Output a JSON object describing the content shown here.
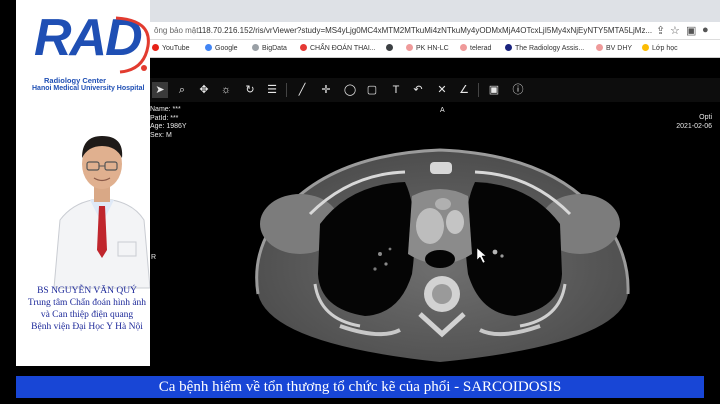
{
  "logo": {
    "letters": "RAD",
    "center_name": "Radiology Center",
    "hospital_name": "Hanoi Medical University Hospital"
  },
  "presenter": {
    "name": "BS NGUYỄN VĂN QUÝ",
    "line2": "Trung tâm Chẩn đoán hình ảnh",
    "line3": "và Can thiệp điện quang",
    "line4": "Bệnh viện Đại Học Y Hà Nội"
  },
  "browser": {
    "security_label": "ông bảo mật",
    "url": "118.70.216.152/ris/vrViewer?study=MS4yLjg0MC4xMTM2MTkuMi4zNTkuMy4yODMxMjA4OTcxLjI5My4xNjEyNTY5MTA5LjMz...",
    "bookmarks": [
      {
        "label": "YouTube",
        "color": "#e62117"
      },
      {
        "label": "Google",
        "color": "#4285f4"
      },
      {
        "label": "BigData",
        "color": "#9aa0a6"
      },
      {
        "label": "CHẨN ĐOÁN THAI...",
        "color": "#e53935"
      },
      {
        "label": "",
        "color": "#3c4043"
      },
      {
        "label": "PK HN-LC",
        "color": "#ef9a9a"
      },
      {
        "label": "telerad",
        "color": "#ef9a9a"
      },
      {
        "label": "The Radiology Assis...",
        "color": "#1a237e"
      },
      {
        "label": "BV DHY",
        "color": "#ef9a9a"
      },
      {
        "label": "Lớp học",
        "color": "#fbbc04"
      }
    ]
  },
  "viewer": {
    "patient_name": "Name: ***",
    "patient_id": "PatId: ***",
    "patient_age": "Age: 1986Y",
    "patient_sex": "Sex: M",
    "orientation_top": "A",
    "orientation_left": "R",
    "right_line1": "Opti",
    "right_line2": "2021-02-06"
  },
  "caption": "Ca bệnh hiếm về tổn thương tổ chức kẽ của phổi - SARCOIDOSIS"
}
